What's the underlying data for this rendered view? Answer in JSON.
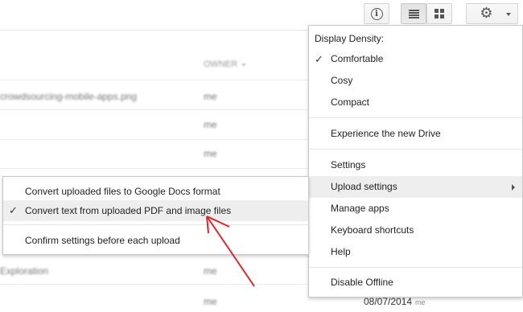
{
  "colors": {
    "highlight": "#eeeeee",
    "arrow": "#e0242a",
    "separator": "#e5e5e5"
  },
  "toolbar": {
    "info_icon": "i",
    "buttons": [
      "info-icon",
      "list-view-icon",
      "grid-view-icon",
      "gear-icon"
    ]
  },
  "file_list": {
    "header_owner": "OWNER",
    "rows": [
      {
        "name": "crowdsourcing-mobile-apps.png",
        "owner": "me"
      },
      {
        "name": "",
        "owner": "me"
      },
      {
        "name": "",
        "owner": "me"
      },
      {
        "name": "",
        "owner": "me"
      },
      {
        "name": "",
        "owner": ""
      },
      {
        "name": "",
        "owner": ""
      },
      {
        "name": "Exploration",
        "owner": "me"
      },
      {
        "name": "",
        "owner": "me",
        "date": "08/07/2014",
        "modified_by": "me"
      }
    ]
  },
  "settings_menu": {
    "density_label": "Display Density:",
    "density_options": [
      {
        "label": "Comfortable",
        "checked": true
      },
      {
        "label": "Cosy",
        "checked": false
      },
      {
        "label": "Compact",
        "checked": false
      }
    ],
    "new_drive": "Experience the new Drive",
    "items": [
      {
        "label": "Settings"
      },
      {
        "label": "Upload settings",
        "highlighted": true,
        "submenu": true
      },
      {
        "label": "Manage apps"
      },
      {
        "label": "Keyboard shortcuts"
      },
      {
        "label": "Help"
      }
    ],
    "offline": "Disable Offline"
  },
  "upload_menu": {
    "items": [
      {
        "label": "Convert uploaded files to Google Docs format",
        "checked": false
      },
      {
        "label": "Convert text from uploaded PDF and image files",
        "checked": true,
        "highlighted": true
      },
      {
        "label": "Confirm settings before each upload",
        "checked": false
      }
    ]
  },
  "checkmark": "✓"
}
